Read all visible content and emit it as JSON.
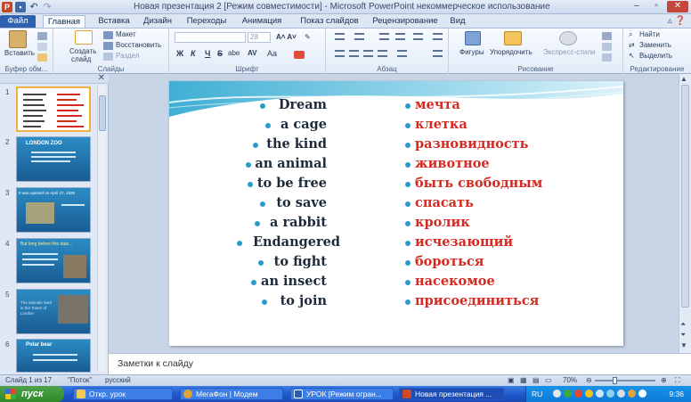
{
  "window": {
    "title": "Новая презентация 2 [Режим совместимости]  -  Microsoft PowerPoint некоммерческое использование"
  },
  "tabs": [
    "Файл",
    "Главная",
    "Вставка",
    "Дизайн",
    "Переходы",
    "Анимация",
    "Показ слайдов",
    "Рецензирование",
    "Вид"
  ],
  "ribbon": {
    "clipboard": {
      "paste": "Вставить",
      "group": "Буфер обм..."
    },
    "slides": {
      "new_slide_1": "Создать",
      "new_slide_2": "слайд",
      "layout": "Макет",
      "reset": "Восстановить",
      "section": "Раздел",
      "group": "Слайды"
    },
    "font": {
      "font_name": "",
      "font_size": "28",
      "group": "Шрифт",
      "bold": "Ж",
      "italic": "К",
      "underline": "Ч",
      "strike": "S",
      "shadow": "abe",
      "spacing": "AV",
      "case": "Aa"
    },
    "paragraph": {
      "group": "Абзац"
    },
    "drawing": {
      "shapes": "Фигуры",
      "arrange": "Упорядочить",
      "quick_styles": "Экспресс-стили",
      "group": "Рисование"
    },
    "editing": {
      "find": "Найти",
      "replace": "Заменить",
      "select": "Выделить",
      "group": "Редактирование"
    }
  },
  "thumbnails": [
    {
      "num": "1",
      "title": ""
    },
    {
      "num": "2",
      "title": "LONDON ZOO"
    },
    {
      "num": "3",
      "title": "It was opened on April 27, 1828"
    },
    {
      "num": "4",
      "title": "But long before this date..."
    },
    {
      "num": "5",
      "title": "The animals lived in the Tower of London"
    },
    {
      "num": "6",
      "title": "Polar bear"
    }
  ],
  "slide": {
    "rows": [
      {
        "en": "Dream",
        "ru": "мечта"
      },
      {
        "en": "a cage",
        "ru": "клетка"
      },
      {
        "en": "the kind",
        "ru": "разновидность"
      },
      {
        "en": "an animal",
        "ru": "животное"
      },
      {
        "en": "to be free",
        "ru": "быть свободным"
      },
      {
        "en": "to save",
        "ru": "спасать"
      },
      {
        "en": "a rabbit",
        "ru": "кролик"
      },
      {
        "en": "Endangered",
        "ru": "исчезающий"
      },
      {
        "en": "to fight",
        "ru": "бороться"
      },
      {
        "en": "an insect",
        "ru": "насекомое"
      },
      {
        "en": "to join",
        "ru": "присоединиться"
      }
    ]
  },
  "notes": {
    "placeholder": "Заметки к слайду"
  },
  "status": {
    "slide": "Слайд 1 из 17",
    "theme": "\"Поток\"",
    "language": "русский",
    "zoom": "70%"
  },
  "taskbar": {
    "start": "пуск",
    "tasks": [
      "Откр. урок",
      "МегаФон | Модем",
      "УРОК [Режим огран...",
      "Новая презентация ..."
    ],
    "lang": "RU",
    "clock": "9:36"
  },
  "colors": {
    "english_text": "#1c2a3a",
    "russian_text": "#d42a22",
    "bullet": "#2a9bc6",
    "file_tab": "#2e62b0"
  }
}
